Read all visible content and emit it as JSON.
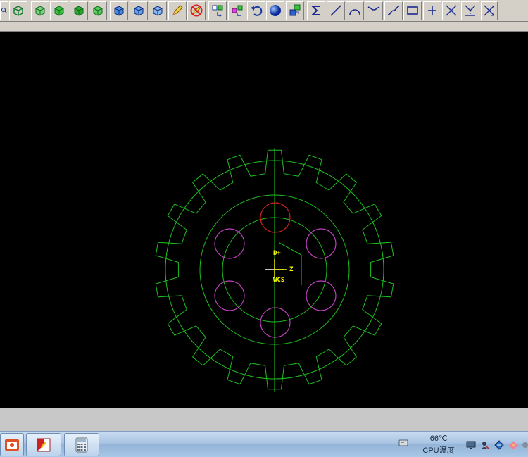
{
  "toolbar": {
    "buttons": [
      "zoom-icon",
      "wireframe-cube-icon",
      "cube-green-1-icon",
      "cube-green-2-icon",
      "cube-green-3-icon",
      "cube-green-4-icon",
      "cube-blue-1-icon",
      "cube-blue-2-icon",
      "cube-blue-3-icon",
      "pencil-icon",
      "no-edit-icon",
      "transform-1-icon",
      "transform-2-icon",
      "undo-icon",
      "sphere-icon",
      "layers-icon",
      "sigma-icon",
      "line-icon",
      "arc-icon",
      "tangent-arc-icon",
      "spline-icon",
      "rectangle-icon",
      "point-icon",
      "trim-icon",
      "extend-icon",
      "break-icon"
    ]
  },
  "viewport": {
    "origin_labels": {
      "top": "D+",
      "right": "Z",
      "bottom": "WCS"
    },
    "colors": {
      "gear": "#1fbf1f",
      "selected_hole": "#d42020",
      "holes": "#c040c0",
      "axis": "#ffff00"
    }
  },
  "taskbar": {
    "cpu_temp": "66℃",
    "cpu_label": "CPU温度"
  }
}
